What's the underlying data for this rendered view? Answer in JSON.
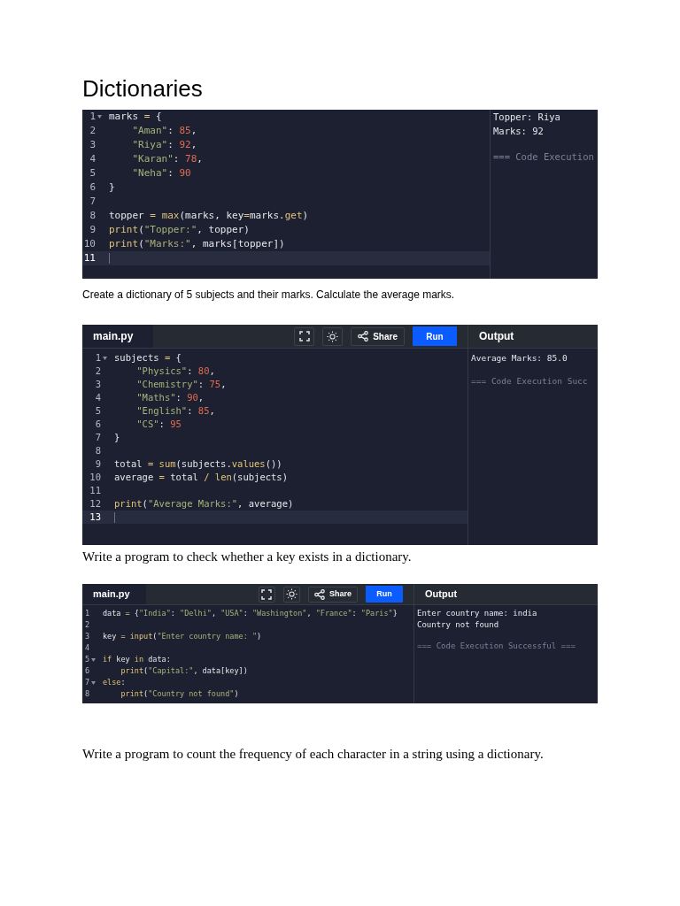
{
  "sections": [
    {
      "kind": "heading",
      "text": "Dictionaries"
    },
    {
      "kind": "editor",
      "code": [
        {
          "num": "1",
          "fold": true,
          "active": false,
          "tokens": [
            {
              "kind": "plain",
              "text": "marks"
            },
            {
              "kind": "op",
              "text": " = "
            },
            {
              "kind": "plain",
              "text": "{"
            }
          ]
        },
        {
          "num": "2",
          "fold": false,
          "active": false,
          "tokens": [
            {
              "kind": "str",
              "text": "    \"Aman\""
            },
            {
              "kind": "plain",
              "text": ": "
            },
            {
              "kind": "num",
              "text": "85"
            },
            {
              "kind": "plain",
              "text": ","
            }
          ]
        },
        {
          "num": "3",
          "fold": false,
          "active": false,
          "tokens": [
            {
              "kind": "str",
              "text": "    \"Riya\""
            },
            {
              "kind": "plain",
              "text": ": "
            },
            {
              "kind": "num",
              "text": "92"
            },
            {
              "kind": "plain",
              "text": ","
            }
          ]
        },
        {
          "num": "4",
          "fold": false,
          "active": false,
          "tokens": [
            {
              "kind": "str",
              "text": "    \"Karan\""
            },
            {
              "kind": "plain",
              "text": ": "
            },
            {
              "kind": "num",
              "text": "78"
            },
            {
              "kind": "plain",
              "text": ","
            }
          ]
        },
        {
          "num": "5",
          "fold": false,
          "active": false,
          "tokens": [
            {
              "kind": "str",
              "text": "    \"Neha\""
            },
            {
              "kind": "plain",
              "text": ": "
            },
            {
              "kind": "num",
              "text": "90"
            }
          ]
        },
        {
          "num": "6",
          "fold": false,
          "active": false,
          "tokens": [
            {
              "kind": "plain",
              "text": "}"
            }
          ]
        },
        {
          "num": "7",
          "fold": false,
          "active": false
        },
        {
          "num": "8",
          "fold": false,
          "active": false,
          "tokens": [
            {
              "kind": "plain",
              "text": "topper"
            },
            {
              "kind": "op",
              "text": " = "
            },
            {
              "kind": "func",
              "text": "max"
            },
            {
              "kind": "plain",
              "text": "(marks, key"
            },
            {
              "kind": "op",
              "text": "="
            },
            {
              "kind": "plain",
              "text": "marks."
            },
            {
              "kind": "func",
              "text": "get"
            },
            {
              "kind": "plain",
              "text": ")"
            }
          ]
        },
        {
          "num": "9",
          "fold": false,
          "active": false,
          "tokens": [
            {
              "kind": "func",
              "text": "print"
            },
            {
              "kind": "plain",
              "text": "("
            },
            {
              "kind": "str",
              "text": "\"Topper:\""
            },
            {
              "kind": "plain",
              "text": ", topper)"
            }
          ]
        },
        {
          "num": "10",
          "fold": false,
          "active": false,
          "tokens": [
            {
              "kind": "func",
              "text": "print"
            },
            {
              "kind": "plain",
              "text": "("
            },
            {
              "kind": "str",
              "text": "\"Marks:\""
            },
            {
              "kind": "plain",
              "text": ", marks[topper])"
            }
          ]
        },
        {
          "num": "11",
          "fold": false,
          "active": true
        }
      ],
      "output": [
        {
          "kind": "stdout",
          "text": "Topper: Riya"
        },
        {
          "kind": "stdout",
          "text": "Marks: 92"
        },
        {
          "kind": "status",
          "text": "=== Code Execution"
        }
      ]
    },
    {
      "kind": "instruction",
      "text": "Create a dictionary of 5 subjects and their marks. Calculate the average marks."
    },
    {
      "kind": "editor",
      "toolbar": {
        "file": "main.py",
        "buttons": [
          {
            "kind": "fullscreen"
          },
          {
            "kind": "theme"
          },
          {
            "kind": "share",
            "label": "Share"
          },
          {
            "kind": "run",
            "label": "Run"
          }
        ],
        "output_title": "Output"
      },
      "code": [
        {
          "num": "1",
          "fold": true,
          "active": false,
          "tokens": [
            {
              "kind": "plain",
              "text": "subjects"
            },
            {
              "kind": "op",
              "text": " = "
            },
            {
              "kind": "plain",
              "text": "{"
            }
          ]
        },
        {
          "num": "2",
          "fold": false,
          "active": false,
          "tokens": [
            {
              "kind": "str",
              "text": "    \"Physics\""
            },
            {
              "kind": "plain",
              "text": ": "
            },
            {
              "kind": "num",
              "text": "80"
            },
            {
              "kind": "plain",
              "text": ","
            }
          ]
        },
        {
          "num": "3",
          "fold": false,
          "active": false,
          "tokens": [
            {
              "kind": "str",
              "text": "    \"Chemistry\""
            },
            {
              "kind": "plain",
              "text": ": "
            },
            {
              "kind": "num",
              "text": "75"
            },
            {
              "kind": "plain",
              "text": ","
            }
          ]
        },
        {
          "num": "4",
          "fold": false,
          "active": false,
          "tokens": [
            {
              "kind": "str",
              "text": "    \"Maths\""
            },
            {
              "kind": "plain",
              "text": ": "
            },
            {
              "kind": "num",
              "text": "90"
            },
            {
              "kind": "plain",
              "text": ","
            }
          ]
        },
        {
          "num": "5",
          "fold": false,
          "active": false,
          "tokens": [
            {
              "kind": "str",
              "text": "    \"English\""
            },
            {
              "kind": "plain",
              "text": ": "
            },
            {
              "kind": "num",
              "text": "85"
            },
            {
              "kind": "plain",
              "text": ","
            }
          ]
        },
        {
          "num": "6",
          "fold": false,
          "active": false,
          "tokens": [
            {
              "kind": "str",
              "text": "    \"CS\""
            },
            {
              "kind": "plain",
              "text": ": "
            },
            {
              "kind": "num",
              "text": "95"
            }
          ]
        },
        {
          "num": "7",
          "fold": false,
          "active": false,
          "tokens": [
            {
              "kind": "plain",
              "text": "}"
            }
          ]
        },
        {
          "num": "8",
          "fold": false,
          "active": false
        },
        {
          "num": "9",
          "fold": false,
          "active": false,
          "tokens": [
            {
              "kind": "plain",
              "text": "total"
            },
            {
              "kind": "op",
              "text": " = "
            },
            {
              "kind": "func",
              "text": "sum"
            },
            {
              "kind": "plain",
              "text": "(subjects."
            },
            {
              "kind": "func",
              "text": "values"
            },
            {
              "kind": "plain",
              "text": "())"
            }
          ]
        },
        {
          "num": "10",
          "fold": false,
          "active": false,
          "tokens": [
            {
              "kind": "plain",
              "text": "average"
            },
            {
              "kind": "op",
              "text": " = "
            },
            {
              "kind": "plain",
              "text": "total"
            },
            {
              "kind": "op",
              "text": " / "
            },
            {
              "kind": "func",
              "text": "len"
            },
            {
              "kind": "plain",
              "text": "(subjects)"
            }
          ]
        },
        {
          "num": "11",
          "fold": false,
          "active": false
        },
        {
          "num": "12",
          "fold": false,
          "active": false,
          "tokens": [
            {
              "kind": "func",
              "text": "print"
            },
            {
              "kind": "plain",
              "text": "("
            },
            {
              "kind": "str",
              "text": "\"Average Marks:\""
            },
            {
              "kind": "plain",
              "text": ", average)"
            }
          ]
        },
        {
          "num": "13",
          "fold": false,
          "active": true
        }
      ],
      "output": [
        {
          "kind": "stdout",
          "text": "Average Marks: 85.0"
        },
        {
          "kind": "status",
          "text": "=== Code Execution Succ"
        }
      ]
    },
    {
      "kind": "question",
      "text": "Write a program to check whether a key exists in a dictionary."
    },
    {
      "kind": "editor",
      "toolbar": {
        "file": "main.py",
        "buttons": [
          {
            "kind": "fullscreen"
          },
          {
            "kind": "theme"
          },
          {
            "kind": "share",
            "label": "Share"
          },
          {
            "kind": "run",
            "label": "Run"
          }
        ],
        "output_title": "Output"
      },
      "code": [
        {
          "num": "1",
          "fold": false,
          "active": false,
          "tokens": [
            {
              "kind": "plain",
              "text": "data"
            },
            {
              "kind": "op",
              "text": " = "
            },
            {
              "kind": "plain",
              "text": "{"
            },
            {
              "kind": "str",
              "text": "\"India\""
            },
            {
              "kind": "plain",
              "text": ": "
            },
            {
              "kind": "str",
              "text": "\"Delhi\""
            },
            {
              "kind": "plain",
              "text": ", "
            },
            {
              "kind": "str",
              "text": "\"USA\""
            },
            {
              "kind": "plain",
              "text": ": "
            },
            {
              "kind": "str",
              "text": "\"Washington\""
            },
            {
              "kind": "plain",
              "text": ", "
            },
            {
              "kind": "str",
              "text": "\"France\""
            },
            {
              "kind": "plain",
              "text": ": "
            },
            {
              "kind": "str",
              "text": "\"Paris\""
            },
            {
              "kind": "plain",
              "text": "}"
            }
          ]
        },
        {
          "num": "2",
          "fold": false,
          "active": false
        },
        {
          "num": "3",
          "fold": false,
          "active": false,
          "tokens": [
            {
              "kind": "plain",
              "text": "key"
            },
            {
              "kind": "op",
              "text": " = "
            },
            {
              "kind": "func",
              "text": "input"
            },
            {
              "kind": "plain",
              "text": "("
            },
            {
              "kind": "str",
              "text": "\"Enter country name: \""
            },
            {
              "kind": "plain",
              "text": ")"
            }
          ]
        },
        {
          "num": "4",
          "fold": false,
          "active": false
        },
        {
          "num": "5",
          "fold": true,
          "active": false,
          "tokens": [
            {
              "kind": "kw",
              "text": "if"
            },
            {
              "kind": "plain",
              "text": " key "
            },
            {
              "kind": "kw",
              "text": "in"
            },
            {
              "kind": "plain",
              "text": " data:"
            }
          ]
        },
        {
          "num": "6",
          "fold": false,
          "active": false,
          "tokens": [
            {
              "kind": "func",
              "text": "    print"
            },
            {
              "kind": "plain",
              "text": "("
            },
            {
              "kind": "str",
              "text": "\"Capital:\""
            },
            {
              "kind": "plain",
              "text": ", data[key])"
            }
          ]
        },
        {
          "num": "7",
          "fold": true,
          "active": false,
          "tokens": [
            {
              "kind": "kw",
              "text": "else"
            },
            {
              "kind": "plain",
              "text": ":"
            }
          ]
        },
        {
          "num": "8",
          "fold": false,
          "active": false,
          "tokens": [
            {
              "kind": "func",
              "text": "    print"
            },
            {
              "kind": "plain",
              "text": "("
            },
            {
              "kind": "str",
              "text": "\"Country not found\""
            },
            {
              "kind": "plain",
              "text": ")"
            }
          ]
        }
      ],
      "output": [
        {
          "kind": "stdout",
          "text": "Enter country name: india"
        },
        {
          "kind": "stdout",
          "text": "Country not found"
        },
        {
          "kind": "status",
          "text": "=== Code Execution Successful ==="
        }
      ]
    },
    {
      "kind": "question",
      "text": "Write a program to count the frequency of each character in a string using a dictionary."
    }
  ]
}
